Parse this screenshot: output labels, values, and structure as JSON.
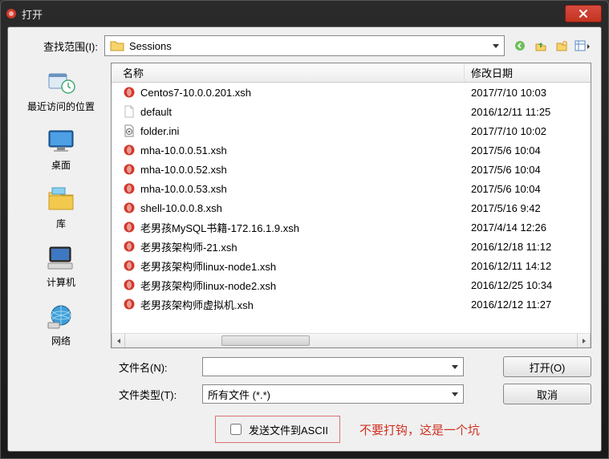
{
  "title": "打开",
  "lookin_label": "查找范围(I):",
  "lookin_value": "Sessions",
  "columns": {
    "name": "名称",
    "date": "修改日期"
  },
  "places": [
    {
      "key": "recent",
      "label": "最近访问的位置"
    },
    {
      "key": "desktop",
      "label": "桌面"
    },
    {
      "key": "library",
      "label": "库"
    },
    {
      "key": "computer",
      "label": "计算机"
    },
    {
      "key": "network",
      "label": "网络"
    }
  ],
  "files": [
    {
      "icon": "xsh",
      "name": "Centos7-10.0.0.201.xsh",
      "date": "2017/7/10 10:03"
    },
    {
      "icon": "blank",
      "name": "default",
      "date": "2016/12/11 11:25"
    },
    {
      "icon": "ini",
      "name": "folder.ini",
      "date": "2017/7/10 10:02"
    },
    {
      "icon": "xsh",
      "name": "mha-10.0.0.51.xsh",
      "date": "2017/5/6 10:04"
    },
    {
      "icon": "xsh",
      "name": "mha-10.0.0.52.xsh",
      "date": "2017/5/6 10:04"
    },
    {
      "icon": "xsh",
      "name": "mha-10.0.0.53.xsh",
      "date": "2017/5/6 10:04"
    },
    {
      "icon": "xsh",
      "name": "shell-10.0.0.8.xsh",
      "date": "2017/5/16 9:42"
    },
    {
      "icon": "xsh",
      "name": "老男孩MySQL书籍-172.16.1.9.xsh",
      "date": "2017/4/14 12:26"
    },
    {
      "icon": "xsh",
      "name": "老男孩架构师-21.xsh",
      "date": "2016/12/18 11:12"
    },
    {
      "icon": "xsh",
      "name": "老男孩架构师linux-node1.xsh",
      "date": "2016/12/11 14:12"
    },
    {
      "icon": "xsh",
      "name": "老男孩架构师linux-node2.xsh",
      "date": "2016/12/25 10:34"
    },
    {
      "icon": "xsh",
      "name": "老男孩架构师虚拟机.xsh",
      "date": "2016/12/12 11:27"
    }
  ],
  "filename_label": "文件名(N):",
  "filename_value": "",
  "filetype_label": "文件类型(T):",
  "filetype_value": "所有文件 (*.*)",
  "open_button": "打开(O)",
  "cancel_button": "取消",
  "ascii_checkbox": "发送文件到ASCII",
  "warning_text": "不要打钩，这是一个坑"
}
